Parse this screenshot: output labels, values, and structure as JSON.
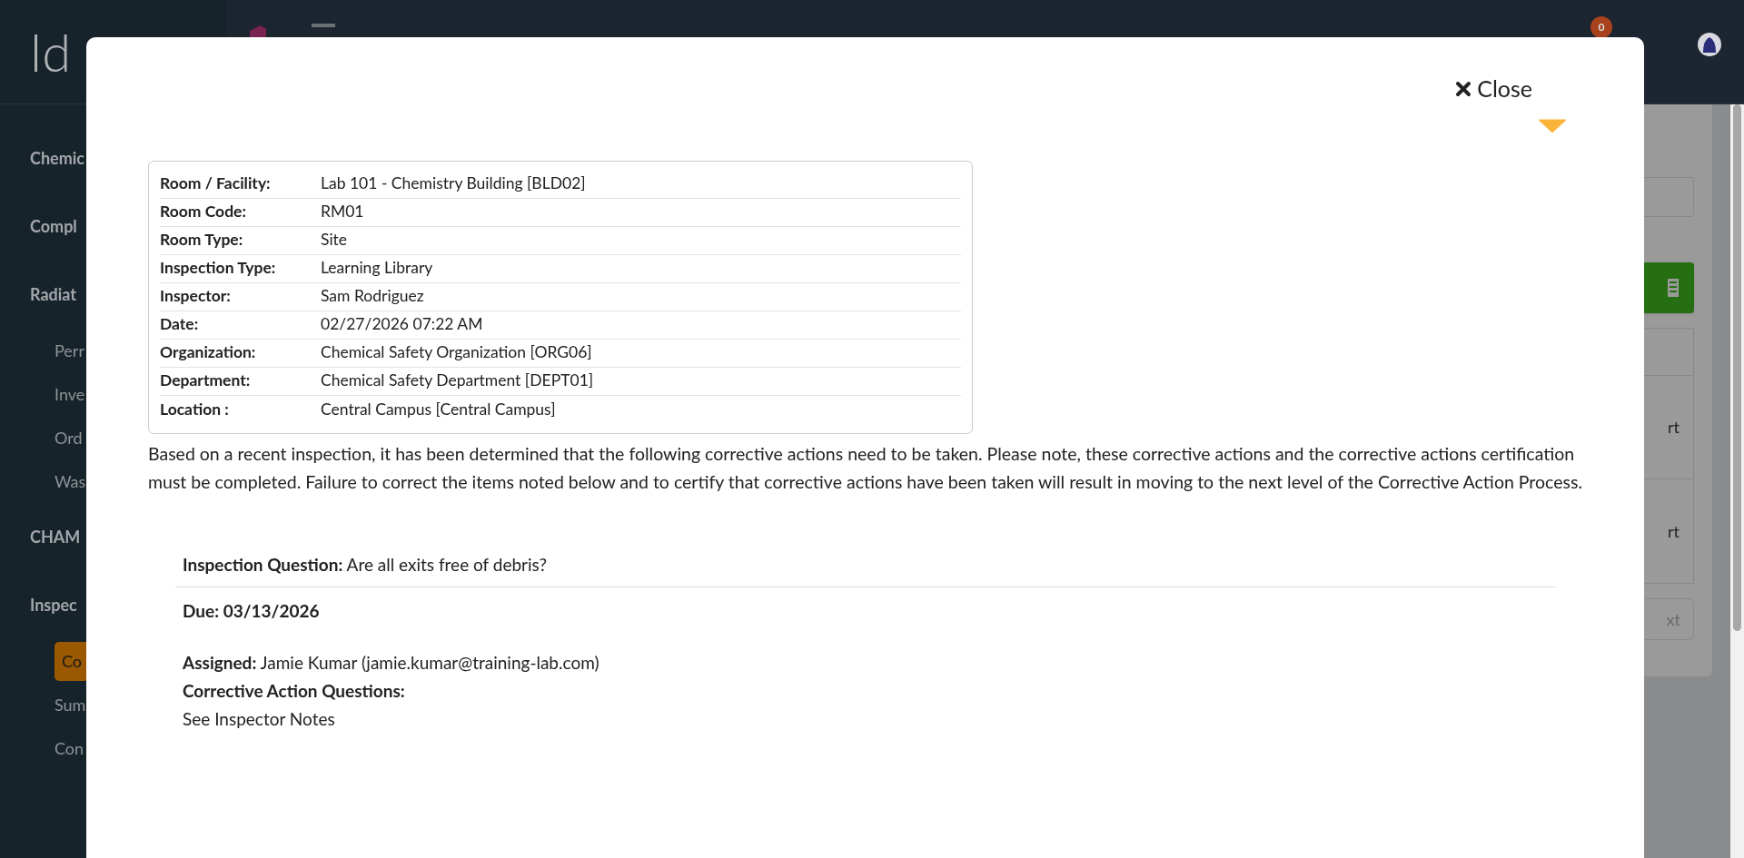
{
  "background": {
    "logo": "Id",
    "notification_count": "0",
    "sidebar": [
      {
        "label": "Chemic",
        "kind": "section"
      },
      {
        "label": "Compl",
        "kind": "section"
      },
      {
        "label": "Radiat",
        "kind": "section"
      },
      {
        "label": "Perr",
        "kind": "item",
        "selected": false
      },
      {
        "label": "Inve",
        "kind": "item",
        "selected": false
      },
      {
        "label": "Ord",
        "kind": "item",
        "selected": false
      },
      {
        "label": "Was",
        "kind": "item",
        "selected": false
      },
      {
        "label": "CHAM",
        "kind": "section"
      },
      {
        "label": "Inspec",
        "kind": "section"
      },
      {
        "label": "Co",
        "kind": "item",
        "selected": true
      },
      {
        "label": "Sum",
        "kind": "item",
        "selected": false
      },
      {
        "label": "Con",
        "kind": "item",
        "selected": false
      }
    ],
    "right_panel": {
      "row_texts": [
        "rt",
        "rt"
      ],
      "button": "xt"
    }
  },
  "modal": {
    "close": "Close",
    "details": [
      {
        "label": "Room / Facility:",
        "value": "Lab 101 - Chemistry Building [BLD02]"
      },
      {
        "label": "Room Code:",
        "value": "RM01"
      },
      {
        "label": "Room Type:",
        "value": "Site"
      },
      {
        "label": "Inspection Type:",
        "value": "Learning Library"
      },
      {
        "label": "Inspector:",
        "value": "Sam Rodriguez"
      },
      {
        "label": "Date:",
        "value": "02/27/2026 07:22 AM"
      },
      {
        "label": "Organization:",
        "value": "Chemical Safety Organization [ORG06]"
      },
      {
        "label": "Department:",
        "value": "Chemical Safety Department [DEPT01]"
      },
      {
        "label": "Location :",
        "value": "Central Campus [Central Campus]"
      }
    ],
    "intro": "Based on a recent inspection, it has been determined that the following corrective actions need to be taken. Please note, these corrective actions and the corrective actions certification must be completed. Failure to correct the items noted below and to certify that corrective actions have been taken will result in moving to the next level of the Corrective Action Process.",
    "corrective_actions": [
      {
        "question": "**Inspection Question:** Are all exits free of debris?",
        "due": "Due: 03/13/2026",
        "assigned": "**Assigned:** Jamie Kumar (jamie.kumar@training-lab.com)",
        "questions_label": "Corrective Action Questions:",
        "questions": "See Inspector Notes"
      }
    ]
  }
}
